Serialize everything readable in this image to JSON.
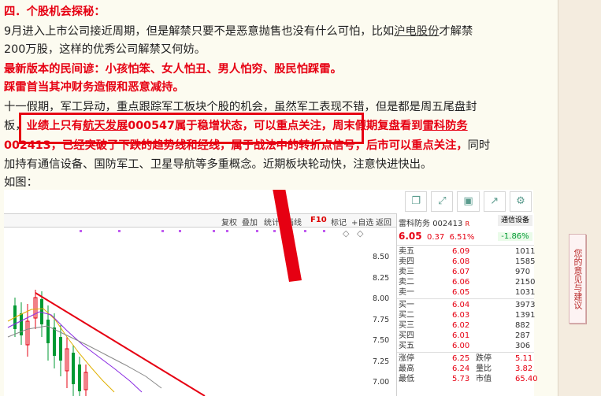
{
  "article": {
    "heading": "四．个股机会探秘：",
    "p1_a": "9月进入上市公司接近周期，但是解禁只要不是恶意抛售也没有什么可怕，比如",
    "p1_link": "沪电股份",
    "p1_b": "才解禁",
    "p1_line2": "200万股，这样的优秀公司解禁又何妨。",
    "red1": "最新版本的民间谚：小孩怕笨、女人怕丑、男人怕穷、股民怕踩雷。",
    "red2": "踩雷首当其冲财务造假和恶意减持。",
    "p3_line1": "十一假期，军工异动，重点跟踪军工板块个股的机会，虽然军工表现不错，但是都是周五尾盘封",
    "p3_l2_start": "板，",
    "p3_l2_red_a": "业绩上只有",
    "p3_l2_link1": "航天发展",
    "p3_l2_red_b": "000547属于稳增状态，可以重点关注，周末假期复盘看到",
    "p3_l2_link2": "雷科防务",
    "p3_l3_red": "002413，已经突破了下跌的趋势线和经线，属于战法中的转折点信号，后市可以重点关注，",
    "p3_l3_end": "同时",
    "p3_line4": "加持有通信设备、国防军工、卫星导航等多重概念。近期板块轮动快，注意快进快出。",
    "p4": "如图："
  },
  "sidebar": {
    "feedback": "您的意见与建议"
  },
  "chart": {
    "icon_buttons": [
      "copy-icon",
      "expand-icon",
      "save-icon",
      "share-icon",
      "settings-icon"
    ],
    "toolbar": [
      "复权",
      "叠加",
      "统计",
      "画线",
      "F10",
      "标记",
      "+自选",
      "返回"
    ],
    "y_ticks": [
      "8.50",
      "8.25",
      "8.00",
      "7.75",
      "7.50",
      "7.25",
      "7.00"
    ],
    "quote": {
      "name": "雷科防务",
      "code": "002413",
      "code_suffix": "R",
      "tag": "通信设备",
      "price": "6.05",
      "change": "0.37",
      "pct": "6.51%",
      "sector_pct": "-1.86%",
      "asks": [
        {
          "label": "卖五",
          "price": "6.09",
          "vol": "1011"
        },
        {
          "label": "卖四",
          "price": "6.08",
          "vol": "1585"
        },
        {
          "label": "卖三",
          "price": "6.07",
          "vol": "970"
        },
        {
          "label": "卖二",
          "price": "6.06",
          "vol": "2150"
        },
        {
          "label": "卖一",
          "price": "6.05",
          "vol": "1031"
        }
      ],
      "bids": [
        {
          "label": "买一",
          "price": "6.04",
          "vol": "3973"
        },
        {
          "label": "买二",
          "price": "6.03",
          "vol": "1391"
        },
        {
          "label": "买三",
          "price": "6.02",
          "vol": "882"
        },
        {
          "label": "买四",
          "price": "6.01",
          "vol": "287"
        },
        {
          "label": "买五",
          "price": "6.00",
          "vol": "306"
        }
      ],
      "stats": [
        {
          "l1": "涨停",
          "v1": "6.25",
          "l2": "跌停",
          "v2": "5.11"
        },
        {
          "l1": "最高",
          "v1": "6.24",
          "l2": "量比",
          "v2": "3.82"
        },
        {
          "l1": "最低",
          "v1": "5.73",
          "l2": "市值",
          "v2": "65.40"
        }
      ]
    }
  },
  "colors": {
    "accent_red": "#e60012",
    "up_red": "#e60012",
    "down_green": "#009933"
  }
}
